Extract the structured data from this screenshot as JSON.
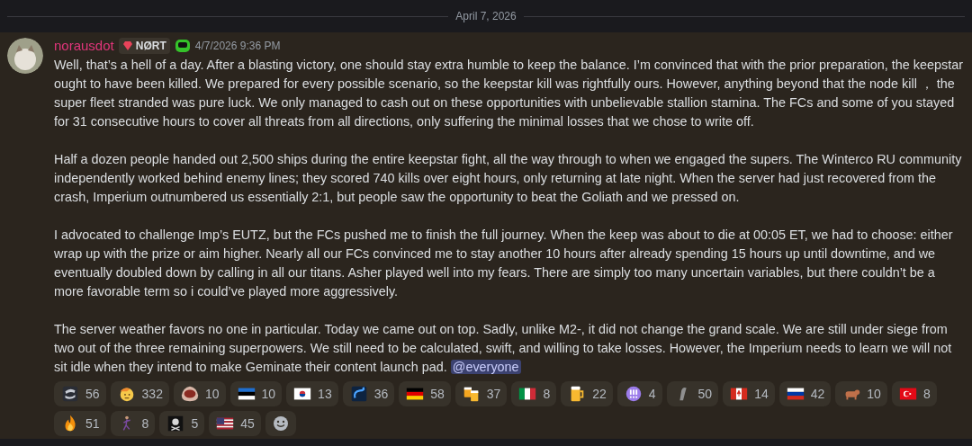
{
  "divider": {
    "date": "April 7, 2026"
  },
  "message": {
    "author": "norausdot",
    "tag": "NØRT",
    "timestamp": "4/7/2026 9:36 PM",
    "paragraphs": [
      "Well, that’s a hell of a day. After a blasting victory, one should stay extra humble to keep the balance. I’m convinced that with the prior preparation, the keepstar ought to have been killed. We prepared for every possible scenario, so the keepstar kill was rightfully ours. However, anything beyond that the node kill ， the super fleet stranded was pure luck. We only managed to cash out on these opportunities with unbelievable stallion stamina. The FCs and some of you stayed for 31 consecutive hours to cover all threats from all directions, only suffering the minimal losses that we chose to write off.",
      "Half a dozen people handed out 2,500 ships during the entire keepstar fight, all the way through to when we engaged the supers. The Winterco RU community independently worked behind enemy lines; they scored 740 kills over eight hours, only returning at late night. When the server had just recovered from the crash, Imperium outnumbered us essentially 2:1, but people saw the opportunity to beat the Goliath and we pressed on.",
      "I advocated to challenge Imp’s EUTZ, but the FCs pushed me to finish the full journey. When the keep was about to die at 00:05 ET, we had to choose: either wrap up with the prize or aim higher. Nearly all our FCs convinced me to stay another 10 hours after already spending 15 hours up until downtime, and we eventually doubled down by calling in all our titans. Asher played well into my fears. There are simply too many uncertain variables, but there couldn’t be a more favorable term so i could’ve played more aggressively.",
      "The server weather favors no one in particular. Today we came out on top. Sadly, unlike M2-, it did not change the grand scale. We are still under siege from two out of the three remaining superpowers. We still need to be calculated, swift, and willing to take losses. However, the Imperium needs to learn we will not sit idle when they intend to make Geminate their content launch pad."
    ],
    "mention": "@everyone"
  },
  "reactions": [
    {
      "kind": "logo",
      "count": "56"
    },
    {
      "kind": "salute",
      "count": "332"
    },
    {
      "kind": "shell",
      "count": "10"
    },
    {
      "kind": "flag-ee",
      "count": "10"
    },
    {
      "kind": "flag-kr",
      "count": "13"
    },
    {
      "kind": "swirl",
      "count": "36"
    },
    {
      "kind": "flag-de",
      "count": "58"
    },
    {
      "kind": "beers",
      "count": "37"
    },
    {
      "kind": "flag-it",
      "count": "8"
    },
    {
      "kind": "beer",
      "count": "22"
    },
    {
      "kind": "exclaim",
      "count": "4"
    },
    {
      "kind": "sketch",
      "count": "50"
    },
    {
      "kind": "flag-ca",
      "count": "14"
    },
    {
      "kind": "flag-ru",
      "count": "42"
    },
    {
      "kind": "ox",
      "count": "10"
    },
    {
      "kind": "flag-tr",
      "count": "8"
    },
    {
      "kind": "fire",
      "count": "51"
    },
    {
      "kind": "figure",
      "count": "8"
    },
    {
      "kind": "skull",
      "count": "5"
    },
    {
      "kind": "flag-us",
      "count": "45"
    }
  ]
}
